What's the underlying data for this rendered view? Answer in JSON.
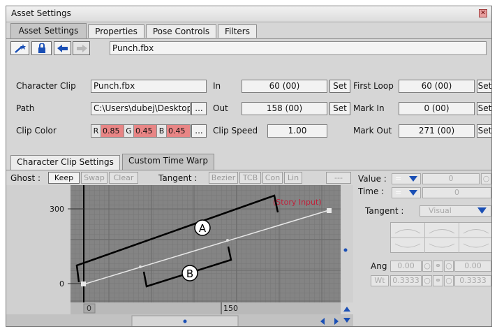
{
  "window": {
    "title": "Asset Settings"
  },
  "tabs": [
    {
      "label": "Asset Settings"
    },
    {
      "label": "Properties"
    },
    {
      "label": "Pose Controls"
    },
    {
      "label": "Filters"
    }
  ],
  "toolbar": {
    "filename": "Punch.fbx",
    "icons": [
      "wand-icon",
      "lock-icon",
      "back-arrow-icon",
      "forward-arrow-icon"
    ]
  },
  "fields": {
    "character_clip": {
      "label": "Character Clip",
      "value": "Punch.fbx"
    },
    "path": {
      "label": "Path",
      "value": "C:\\Users\\dubej\\Desktop",
      "browse": "..."
    },
    "clip_color": {
      "label": "Clip Color",
      "r_label": "R",
      "r": "0.85",
      "g_label": "G",
      "g": "0.45",
      "b_label": "B",
      "b": "0.45",
      "browse": "..."
    },
    "in": {
      "label": "In",
      "value": "60 (00)",
      "set": "Set"
    },
    "out": {
      "label": "Out",
      "value": "158 (00)",
      "set": "Set"
    },
    "clip_speed": {
      "label": "Clip Speed",
      "value": "1.00"
    },
    "first_loop": {
      "label": "First Loop",
      "value": "60 (00)",
      "set": "Set"
    },
    "mark_in": {
      "label": "Mark In",
      "value": "0 (00)",
      "set": "Set"
    },
    "mark_out": {
      "label": "Mark Out",
      "value": "271 (00)",
      "set": "Set"
    }
  },
  "subtabs": [
    {
      "label": "Character Clip Settings"
    },
    {
      "label": "Custom Time Warp"
    }
  ],
  "ghost": {
    "label": "Ghost :",
    "keep": "Keep",
    "swap": "Swap",
    "clear": "Clear"
  },
  "tangent_bar": {
    "label": "Tangent :",
    "bezier": "Bezier",
    "tcb": "TCB",
    "con": "Con",
    "lin": "Lin",
    "dash": "---"
  },
  "graph": {
    "y_labels": [
      "300",
      "0"
    ],
    "x_labels": [
      "0",
      "150"
    ],
    "curve_label": "(Story Input)",
    "annotations": [
      "A",
      "B"
    ]
  },
  "right_panel": {
    "value_label": "Value :",
    "value_op": "=",
    "value": "0",
    "time_label": "Time :",
    "time_op": "=",
    "time": "0",
    "tangent_label": "Tangent :",
    "tangent_value": "Visual",
    "ang_label": "Ang",
    "ang_left": "0.00",
    "ang_right": "0.00",
    "wt_label": "Wt",
    "wt_left": "0.3333",
    "wt_right": "0.3333"
  },
  "colors": {
    "graph_bg": "#848484",
    "curve": "#e8e8e8",
    "label_red": "#c0203a",
    "clip_color": "#e88585",
    "accent_blue": "#1a4fb5"
  }
}
